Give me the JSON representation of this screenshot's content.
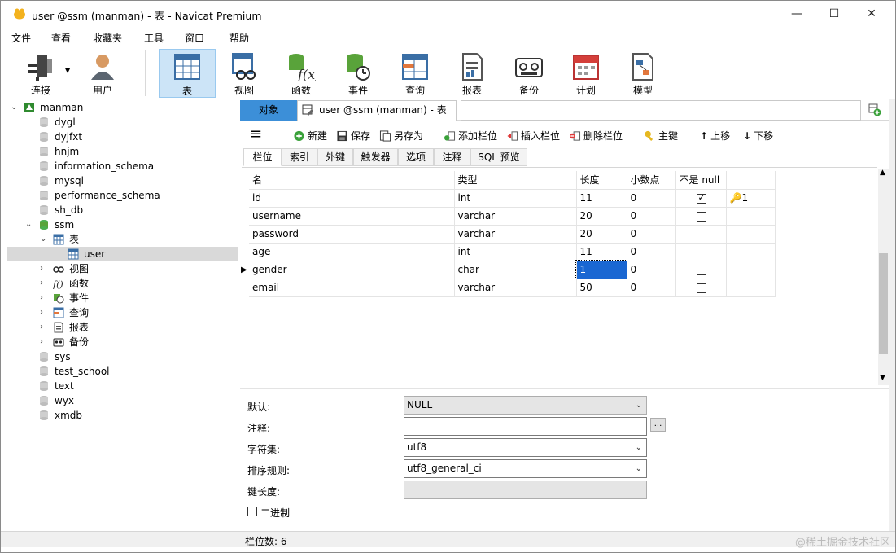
{
  "window": {
    "title": "user @ssm (manman) - 表 - Navicat Premium",
    "controls": {
      "minimize": "—",
      "maximize": "☐",
      "close": "✕"
    }
  },
  "menu": [
    "文件",
    "查看",
    "收藏夹",
    "工具",
    "窗口",
    "帮助"
  ],
  "toolbar": {
    "items": [
      {
        "label": "连接",
        "icon": "plug-icon"
      },
      {
        "label": "用户",
        "icon": "user-icon"
      },
      {
        "label": "表",
        "icon": "table-icon",
        "active": true
      },
      {
        "label": "视图",
        "icon": "view-icon"
      },
      {
        "label": "函数",
        "icon": "function-icon"
      },
      {
        "label": "事件",
        "icon": "event-icon"
      },
      {
        "label": "查询",
        "icon": "query-icon"
      },
      {
        "label": "报表",
        "icon": "report-icon"
      },
      {
        "label": "备份",
        "icon": "backup-icon"
      },
      {
        "label": "计划",
        "icon": "schedule-icon"
      },
      {
        "label": "模型",
        "icon": "model-icon"
      }
    ]
  },
  "tree": {
    "connection": "manman",
    "databases": [
      "dygl",
      "dyjfxt",
      "hnjm",
      "information_schema",
      "mysql",
      "performance_schema",
      "sh_db",
      "ssm",
      "sys",
      "test_school",
      "text",
      "wyx",
      "xmdb"
    ],
    "ssm_children": {
      "tables_label": "表",
      "table_items": [
        "user"
      ],
      "others": [
        "视图",
        "函数",
        "事件",
        "查询",
        "报表",
        "备份"
      ]
    }
  },
  "tabs": {
    "objects": "对象",
    "current": "user @ssm (manman) - 表"
  },
  "edit_toolbar": {
    "menu": "≡",
    "new": "新建",
    "save": "保存",
    "save_as": "另存为",
    "add_field": "添加栏位",
    "insert_field": "插入栏位",
    "delete_field": "删除栏位",
    "primary_key": "主键",
    "move_up": "上移",
    "move_down": "下移"
  },
  "subtabs": [
    "栏位",
    "索引",
    "外键",
    "触发器",
    "选项",
    "注释",
    "SQL 预览"
  ],
  "fields_table": {
    "headers": [
      "名",
      "类型",
      "长度",
      "小数点",
      "不是 null",
      ""
    ],
    "rows": [
      {
        "name": "id",
        "type": "int",
        "length": "11",
        "decimals": "0",
        "not_null": true,
        "key": "1"
      },
      {
        "name": "username",
        "type": "varchar",
        "length": "20",
        "decimals": "0",
        "not_null": false,
        "key": ""
      },
      {
        "name": "password",
        "type": "varchar",
        "length": "20",
        "decimals": "0",
        "not_null": false,
        "key": ""
      },
      {
        "name": "age",
        "type": "int",
        "length": "11",
        "decimals": "0",
        "not_null": false,
        "key": ""
      },
      {
        "name": "gender",
        "type": "char",
        "length": "1",
        "decimals": "0",
        "not_null": false,
        "key": "",
        "current": true
      },
      {
        "name": "email",
        "type": "varchar",
        "length": "50",
        "decimals": "0",
        "not_null": false,
        "key": ""
      }
    ]
  },
  "properties": {
    "default_label": "默认:",
    "default_value": "NULL",
    "comment_label": "注释:",
    "comment_value": "",
    "charset_label": "字符集:",
    "charset_value": "utf8",
    "collation_label": "排序规则:",
    "collation_value": "utf8_general_ci",
    "key_length_label": "键长度:",
    "binary_label": "二进制",
    "dots": "..."
  },
  "status": {
    "field_count": "栏位数: 6"
  },
  "watermark": "@稀土掘金技术社区",
  "colors": {
    "accent": "#3c8fd8",
    "selection": "#1a67d2",
    "toolbar_active": "#cce4f7"
  }
}
